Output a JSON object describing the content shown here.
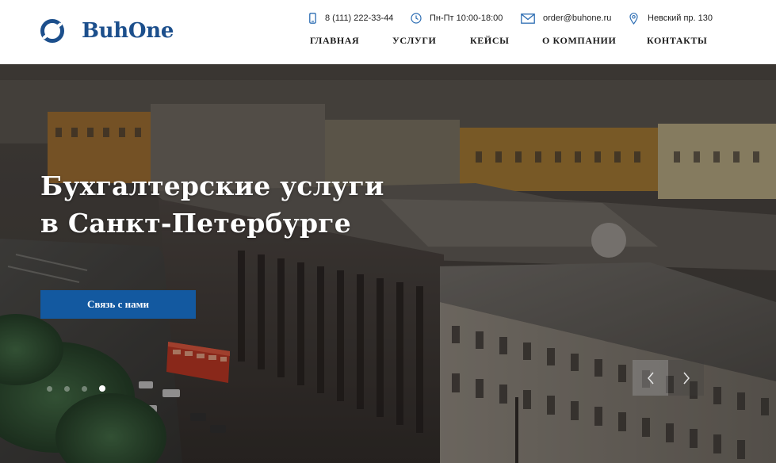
{
  "brand": {
    "name": "BuhOne",
    "color": "#1c4f8c"
  },
  "contacts": {
    "phone": "8 (111) 222-33-44",
    "hours": "Пн-Пт 10:00-18:00",
    "email": "order@buhone.ru",
    "address": "Невский пр. 130",
    "icons": [
      "phone-icon",
      "clock-icon",
      "mail-icon",
      "location-pin-icon"
    ],
    "icon_color": "#2c6db3"
  },
  "nav": {
    "items": [
      {
        "label": "ГЛАВНАЯ"
      },
      {
        "label": "УСЛУГИ"
      },
      {
        "label": "КЕЙСЫ"
      },
      {
        "label": "О КОМПАНИИ"
      },
      {
        "label": "КОНТАКТЫ"
      }
    ]
  },
  "hero": {
    "title_line1": "Бухгалтерские услуги",
    "title_line2": "в Санкт-Петербурге",
    "cta_label": "Связь с нами",
    "cta_color": "#1359a0",
    "slider": {
      "slides_count": 4,
      "active_slide": 4,
      "prev_icon": "chevron-left-icon",
      "next_icon": "chevron-right-icon"
    }
  }
}
